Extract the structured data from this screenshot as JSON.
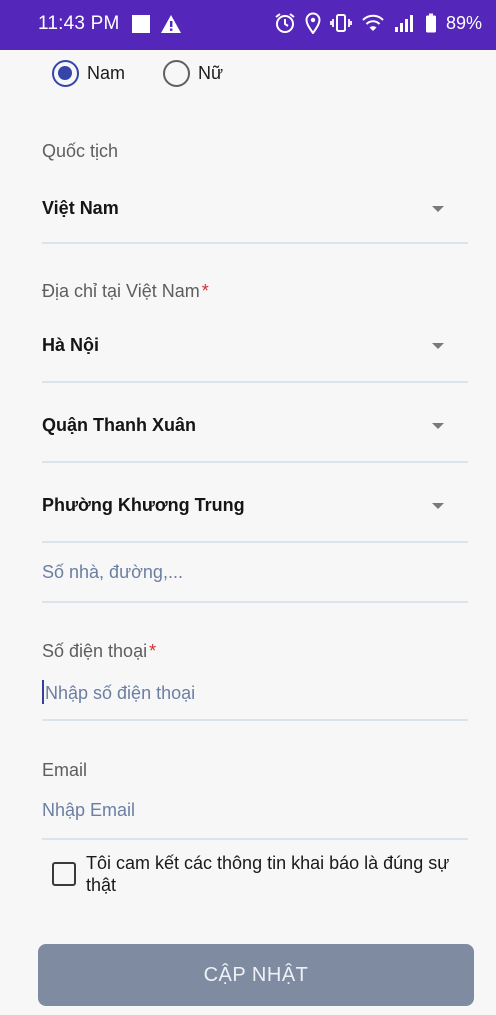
{
  "status_bar": {
    "time": "11:43 PM",
    "battery": "89%",
    "icons": [
      "notification-square-icon",
      "warning-icon",
      "alarm-icon",
      "location-icon",
      "vibrate-icon",
      "wifi-icon",
      "signal-icon",
      "battery-icon"
    ]
  },
  "gender": {
    "options": [
      {
        "label": "Nam",
        "checked": true
      },
      {
        "label": "Nữ",
        "checked": false
      }
    ]
  },
  "nationality": {
    "label": "Quốc tịch",
    "value": "Việt Nam"
  },
  "address": {
    "label": "Địa chỉ tại Việt Nam",
    "required_mark": "*",
    "province": "Hà Nội",
    "district": "Quận Thanh Xuân",
    "ward": "Phường Khương Trung",
    "street_placeholder": "Số nhà, đường,..."
  },
  "phone": {
    "label": "Số điện thoại",
    "required_mark": "*",
    "placeholder": "Nhập số điện thoại"
  },
  "email": {
    "label": "Email",
    "placeholder": "Nhập Email"
  },
  "commitment": {
    "text": "Tôi cam kết các thông tin khai báo là đúng sự thật",
    "checked": false
  },
  "submit_label": "CẬP NHẬT",
  "colors": {
    "status_bar": "#5426b9",
    "radio_accent": "#3545a8",
    "required": "#d32f2f",
    "placeholder": "#6b7fa3",
    "button_bg": "#7e8ba0"
  }
}
